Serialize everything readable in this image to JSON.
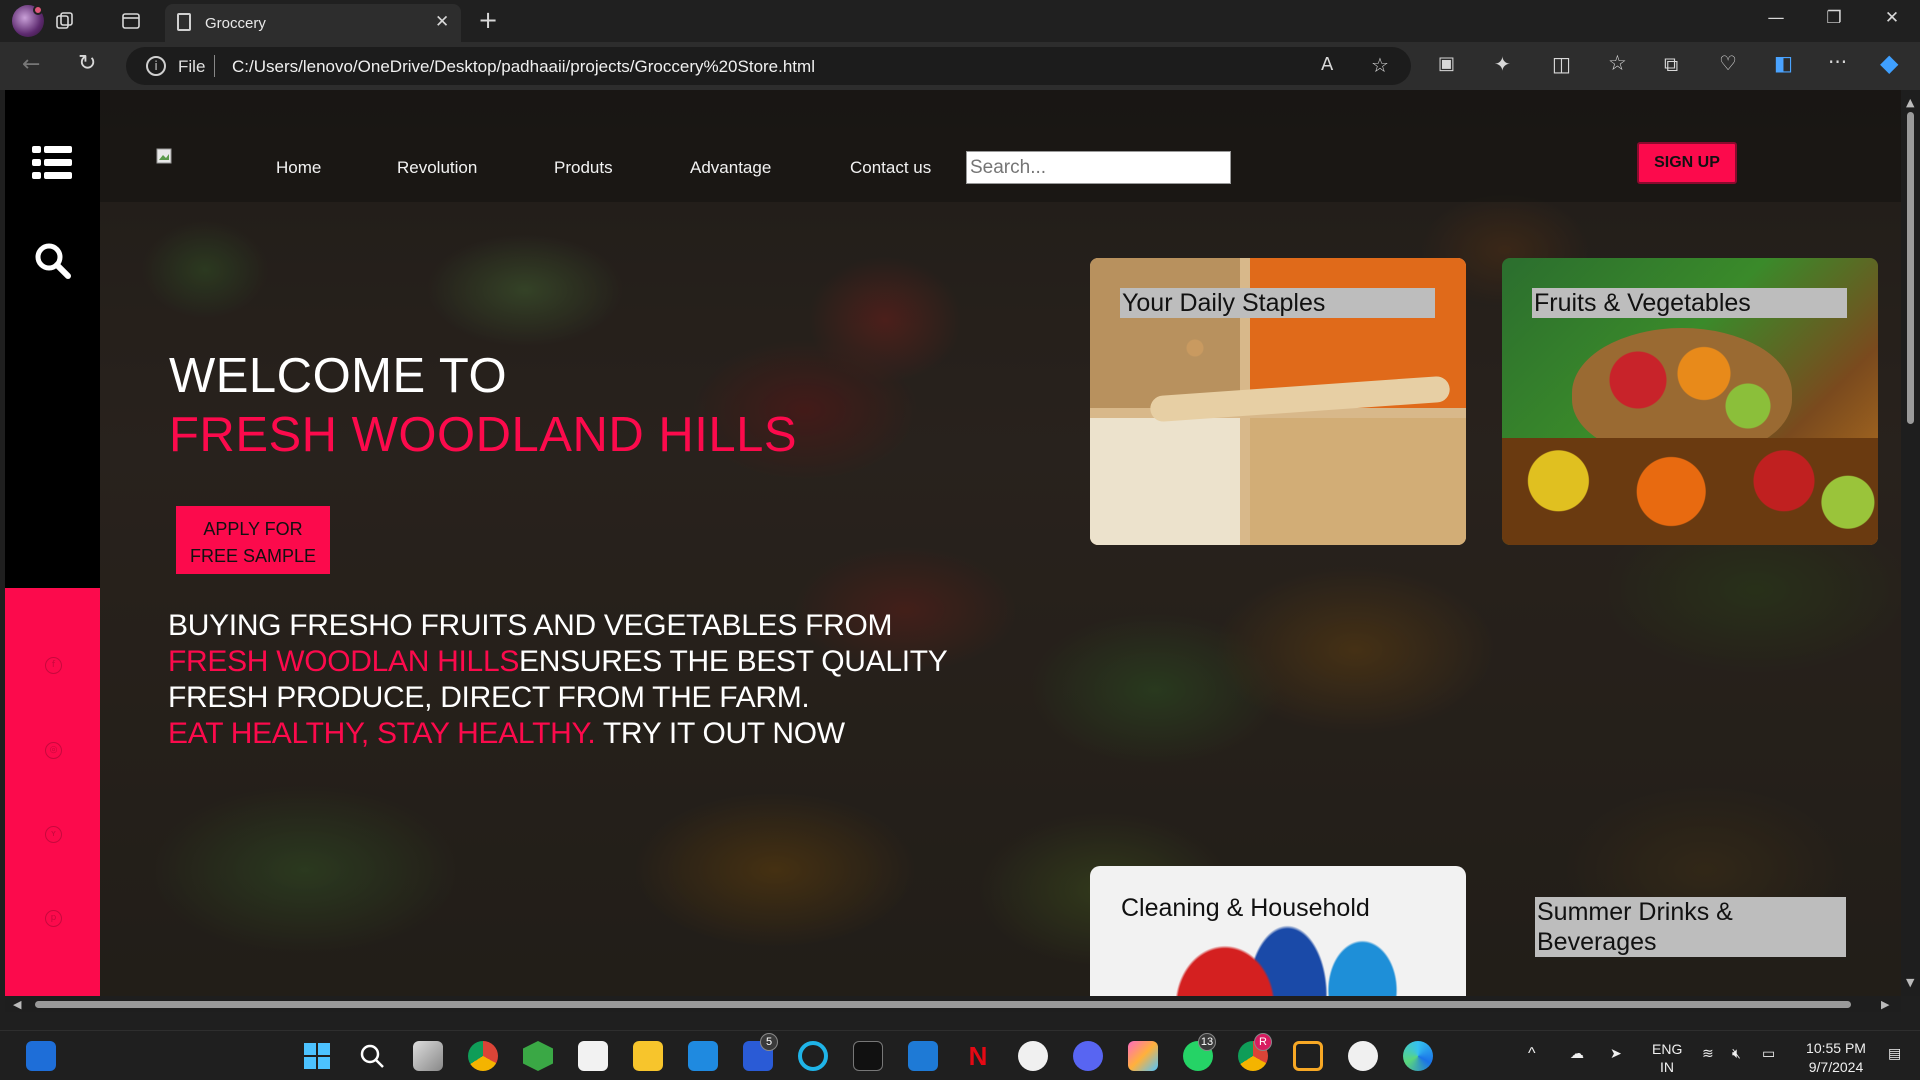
{
  "browser": {
    "tab_title": "Groccery",
    "url_scheme_label": "File",
    "url": "C:/Users/lenovo/OneDrive/Desktop/padhaaii/projects/Groccery%20Store.html"
  },
  "nav": {
    "links": [
      "Home",
      "Revolution",
      "Produts",
      "Advantage",
      "Contact us"
    ],
    "search_placeholder": "Search...",
    "signup_label": "SIGN UP"
  },
  "hero": {
    "welcome": "WELCOME TO",
    "brand": "FRESH WOODLAND HILLS",
    "apply_line1": "APPLY FOR",
    "apply_line2": "FREE SAMPLE",
    "blurb_line1": "BUYING FRESHO FRUITS AND VEGETABLES FROM",
    "blurb_brand": "FRESH WOODLAN HILLS",
    "blurb_line2_rest": "ENSURES THE BEST QUALITY",
    "blurb_line3": "FRESH PRODUCE, DIRECT FROM THE FARM.",
    "blurb_slogan": "EAT HEALTHY, STAY HEALTHY.",
    "blurb_cta": " TRY IT OUT NOW"
  },
  "categories": [
    {
      "label": "Your Daily Staples"
    },
    {
      "label": "Fruits & Vegetables"
    },
    {
      "label": "Cleaning & Household"
    },
    {
      "label": "Summer Drinks & Beverages"
    }
  ],
  "social_icons": [
    "facebook-icon",
    "instagram-icon",
    "twitter-icon",
    "pinterest-icon"
  ],
  "colors": {
    "accent": "#fc0a4c",
    "sidebar": "#000000"
  },
  "taskbar": {
    "lang_top": "ENG",
    "lang_bottom": "IN",
    "time": "10:55 PM",
    "date": "9/7/2024",
    "badges": {
      "lens": "5",
      "whatsapp": "13",
      "chrome_profile": "R"
    }
  }
}
